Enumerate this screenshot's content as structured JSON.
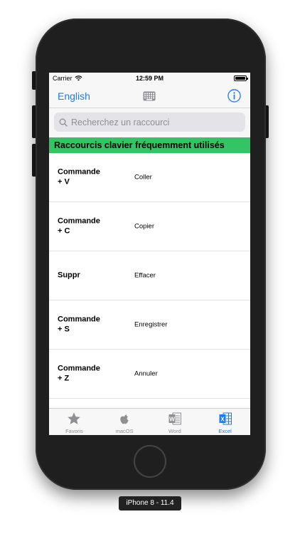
{
  "status_bar": {
    "carrier": "Carrier",
    "time": "12:59 PM"
  },
  "nav": {
    "language_label": "English",
    "center_icon": "keyboard-icon",
    "right_icon": "info-icon",
    "accent_color": "#1a7cf4"
  },
  "search": {
    "placeholder": "Recherchez un raccourci",
    "value": ""
  },
  "section": {
    "title": "Raccourcis clavier fréquemment utilisés",
    "color": "#33c463"
  },
  "shortcuts": [
    {
      "key_line1": "Commande",
      "key_line2": "+ V",
      "action": "Coller"
    },
    {
      "key_line1": "Commande",
      "key_line2": "+ C",
      "action": "Copier"
    },
    {
      "key_line1": "Suppr",
      "key_line2": "",
      "action": "Effacer"
    },
    {
      "key_line1": "Commande",
      "key_line2": "+ S",
      "action": "Enregistrer"
    },
    {
      "key_line1": "Commande",
      "key_line2": "+ Z",
      "action": "Annuler"
    }
  ],
  "tabs": [
    {
      "label": "Favoris",
      "icon": "star-icon",
      "active": false
    },
    {
      "label": "macOS",
      "icon": "apple-icon",
      "active": false
    },
    {
      "label": "Word",
      "icon": "word-icon",
      "active": false
    },
    {
      "label": "Excel",
      "icon": "excel-icon",
      "active": true
    }
  ],
  "device_label": "iPhone 8 - 11.4"
}
